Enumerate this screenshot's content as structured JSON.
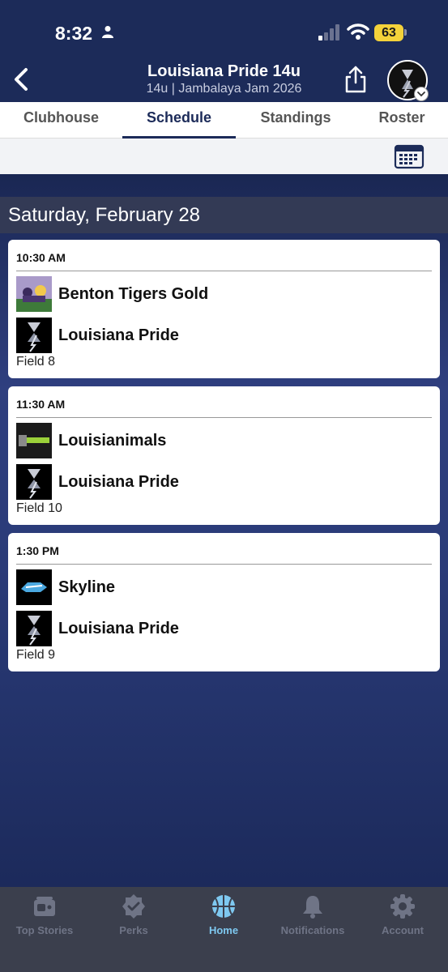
{
  "status_bar": {
    "time": "8:32",
    "battery": "63"
  },
  "header": {
    "title": "Louisiana Pride 14u",
    "subtitle": "14u | Jambalaya Jam 2026"
  },
  "tabs": [
    {
      "label": "Clubhouse"
    },
    {
      "label": "Schedule",
      "active": true
    },
    {
      "label": "Standings"
    },
    {
      "label": "Roster"
    }
  ],
  "schedule": {
    "date": "Saturday, February 28",
    "games": [
      {
        "time": "10:30 AM",
        "home": "Benton Tigers Gold",
        "away": "Louisiana Pride",
        "field": "Field 8"
      },
      {
        "time": "11:30 AM",
        "home": "Louisianimals",
        "away": "Louisiana Pride",
        "field": "Field 10"
      },
      {
        "time": "1:30 PM",
        "home": "Skyline",
        "away": "Louisiana Pride",
        "field": "Field 9"
      }
    ]
  },
  "bottom_nav": [
    {
      "label": "Top Stories",
      "icon": "newspaper-icon"
    },
    {
      "label": "Perks",
      "icon": "badge-check-icon"
    },
    {
      "label": "Home",
      "icon": "basketball-icon",
      "active": true
    },
    {
      "label": "Notifications",
      "icon": "bell-icon"
    },
    {
      "label": "Account",
      "icon": "gear-icon"
    }
  ],
  "colors": {
    "header_bg": "#1c2b59",
    "tab_active": "#1c2b59",
    "battery": "#f4d23a",
    "nav_active": "#7ec8f0",
    "nav_inactive": "#6f7486"
  }
}
